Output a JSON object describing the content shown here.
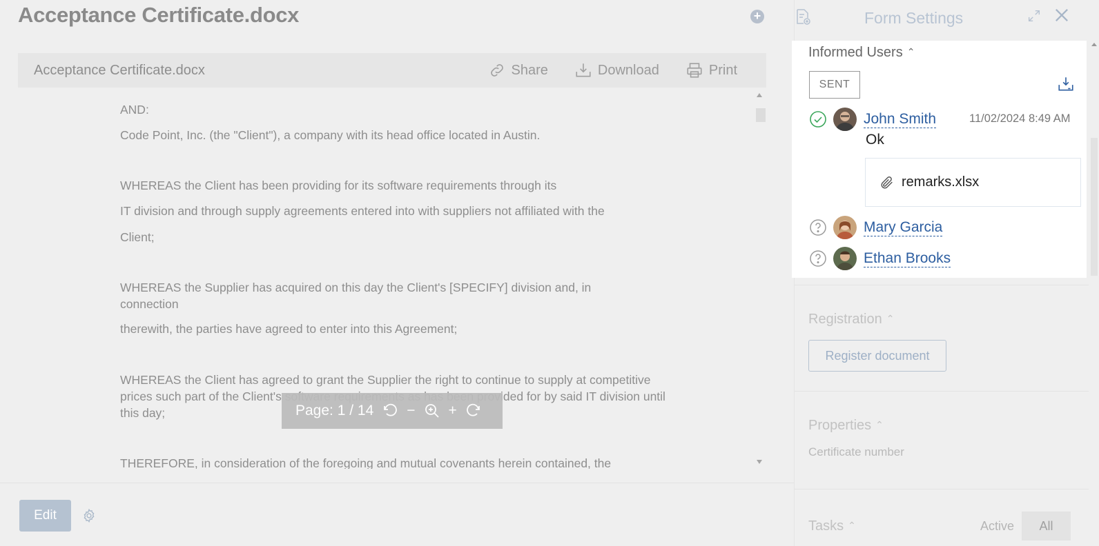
{
  "document": {
    "title": "Acceptance Certificate.docx",
    "viewer_file_name": "Acceptance Certificate.docx",
    "actions": {
      "share": "Share",
      "download": "Download",
      "print": "Print"
    },
    "paragraphs": [
      "AND:",
      "Code Point, Inc. (the \"Client\"), a company with its head office located in Austin.",
      "WHEREAS the Client has been providing for its software requirements through its",
      "IT division and through supply agreements entered into with suppliers not affiliated with the",
      "Client;",
      "WHEREAS the Supplier has acquired on this day the Client's [SPECIFY] division and, in connection",
      "therewith, the parties have agreed to enter into this Agreement;",
      "WHEREAS the Client has agreed to grant the Supplier the right to continue to supply at competitive prices such part of the Client's software requirements as has been provided for by said IT division until this day;",
      "THEREFORE, in consideration of the foregoing and mutual covenants herein contained, the"
    ],
    "page_indicator": "Page: 1 / 14",
    "zoom_out": "−",
    "zoom_in": "+",
    "edit_label": "Edit"
  },
  "panel": {
    "title": "Form Settings",
    "informed_users": {
      "title": "Informed Users",
      "status_tag": "SENT",
      "users": [
        {
          "name": "John Smith",
          "status": "acknowledged",
          "date": "11/02/2024 8:49 AM",
          "comment": "Ok",
          "attachment": "remarks.xlsx"
        },
        {
          "name": "Mary Garcia",
          "status": "pending"
        },
        {
          "name": "Ethan Brooks",
          "status": "pending"
        }
      ]
    },
    "registration": {
      "title": "Registration",
      "button": "Register document"
    },
    "properties": {
      "title": "Properties",
      "field_label": "Certificate number"
    },
    "tasks": {
      "title": "Tasks",
      "filter_active": "Active",
      "filter_all": "All",
      "selected": "All"
    }
  },
  "colors": {
    "link": "#2d5ea0",
    "edit_button": "#b5c2d1",
    "success": "#3aa65a",
    "page_bar": "#bcbcbc"
  },
  "icons": [
    "add-circle-icon",
    "share-icon",
    "download-icon",
    "print-icon",
    "rotate-left-icon",
    "zoom-icon",
    "rotate-right-icon",
    "gear-icon",
    "form-settings-icon",
    "expand-icon",
    "close-icon",
    "download-archive-icon",
    "check-circle-icon",
    "question-circle-icon",
    "paperclip-icon",
    "chevron-up-icon"
  ]
}
